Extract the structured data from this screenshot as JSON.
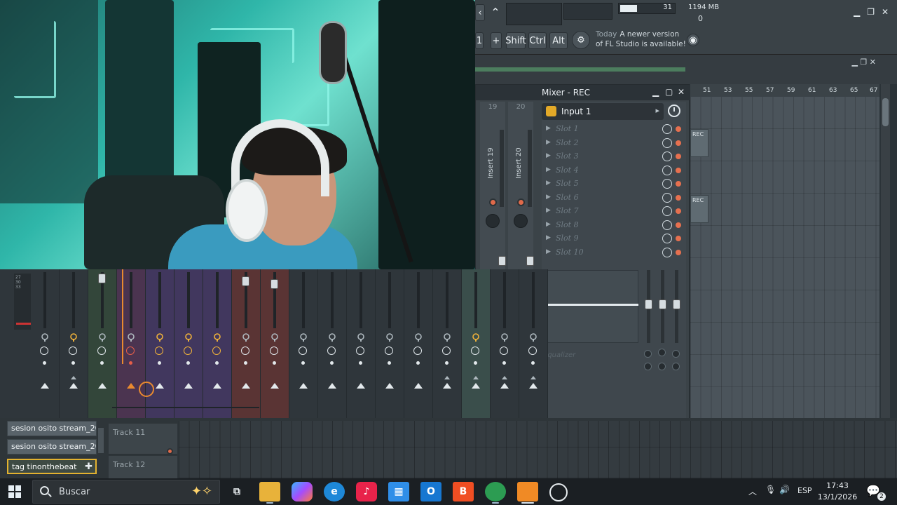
{
  "fl_top": {
    "cpu_value": "31",
    "ram_value": "1194 MB",
    "poly_value": "0",
    "hint_num": "1",
    "hint_plus": "+",
    "shift_label": "Shift",
    "ctrl_label": "Ctrl",
    "alt_label": "Alt",
    "news_today": "Today",
    "news_text": "A newer version of FL Studio is available!"
  },
  "mixer": {
    "title": "Mixer - REC",
    "insert_numbers": [
      "19",
      "20"
    ],
    "insert_names": [
      "Insert 19",
      "Insert 20"
    ],
    "input_label": "Input 1",
    "slots": [
      "Slot 1",
      "Slot 2",
      "Slot 3",
      "Slot 4",
      "Slot 5",
      "Slot 6",
      "Slot 7",
      "Slot 8",
      "Slot 9",
      "Slot 10"
    ],
    "eq_label": "Equalizer"
  },
  "playlist": {
    "ruler": [
      "51",
      "53",
      "55",
      "57",
      "59",
      "61",
      "63",
      "65",
      "67"
    ],
    "clip_labels": [
      "REC",
      "REC"
    ]
  },
  "patterns": [
    {
      "label": "sesion osito stream_202..",
      "selected": false
    },
    {
      "label": "sesion osito stream_202..",
      "selected": false
    },
    {
      "label": "tag tinonthebeat",
      "selected": true
    }
  ],
  "tracks": [
    {
      "label": "Track 11"
    },
    {
      "label": "Track 12"
    }
  ],
  "master_meter_labels": [
    "27",
    "30",
    "33"
  ],
  "taskbar": {
    "search_placeholder": "Buscar",
    "language": "ESP",
    "time": "17:43",
    "date": "13/1/2026",
    "notification_count": "2"
  },
  "colors": {
    "accent_orange": "#f0b23a",
    "record_red": "#e06a4a",
    "selected_border": "#e3b22f"
  }
}
